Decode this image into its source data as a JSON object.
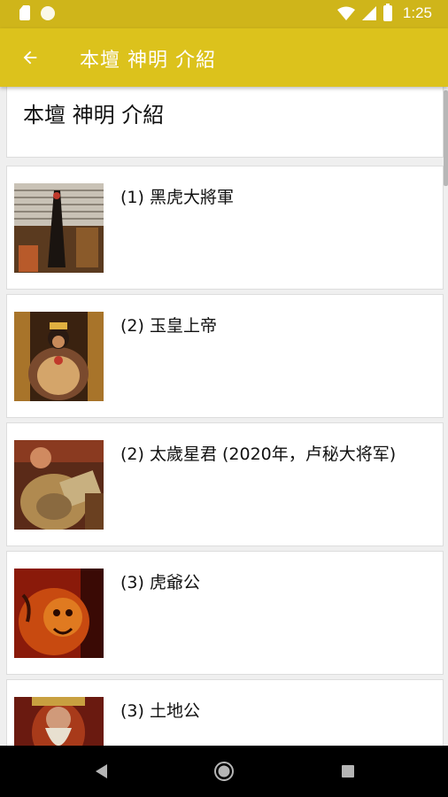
{
  "status_bar": {
    "time": "1:25",
    "icons": [
      "sd-card-icon",
      "circle-icon",
      "wifi-icon",
      "signal-icon",
      "battery-icon"
    ]
  },
  "app_bar": {
    "title": "本壇 神明 介紹",
    "back_icon": "arrow-back-icon"
  },
  "header": {
    "text": "本壇 神明 介紹"
  },
  "items": [
    {
      "label": "(1) 黑虎大將軍"
    },
    {
      "label": "(2) 玉皇上帝"
    },
    {
      "label": "(2) 太歲星君 (2020年，卢秘大将军)"
    },
    {
      "label": "(3) 虎爺公"
    },
    {
      "label": "(3) 土地公"
    }
  ],
  "nav_bar": {
    "buttons": [
      "back-triangle-icon",
      "home-circle-icon",
      "recents-square-icon"
    ]
  },
  "colors": {
    "status_bar": "#cfb51a",
    "app_bar": "#dcc21c",
    "background": "#efefef"
  }
}
